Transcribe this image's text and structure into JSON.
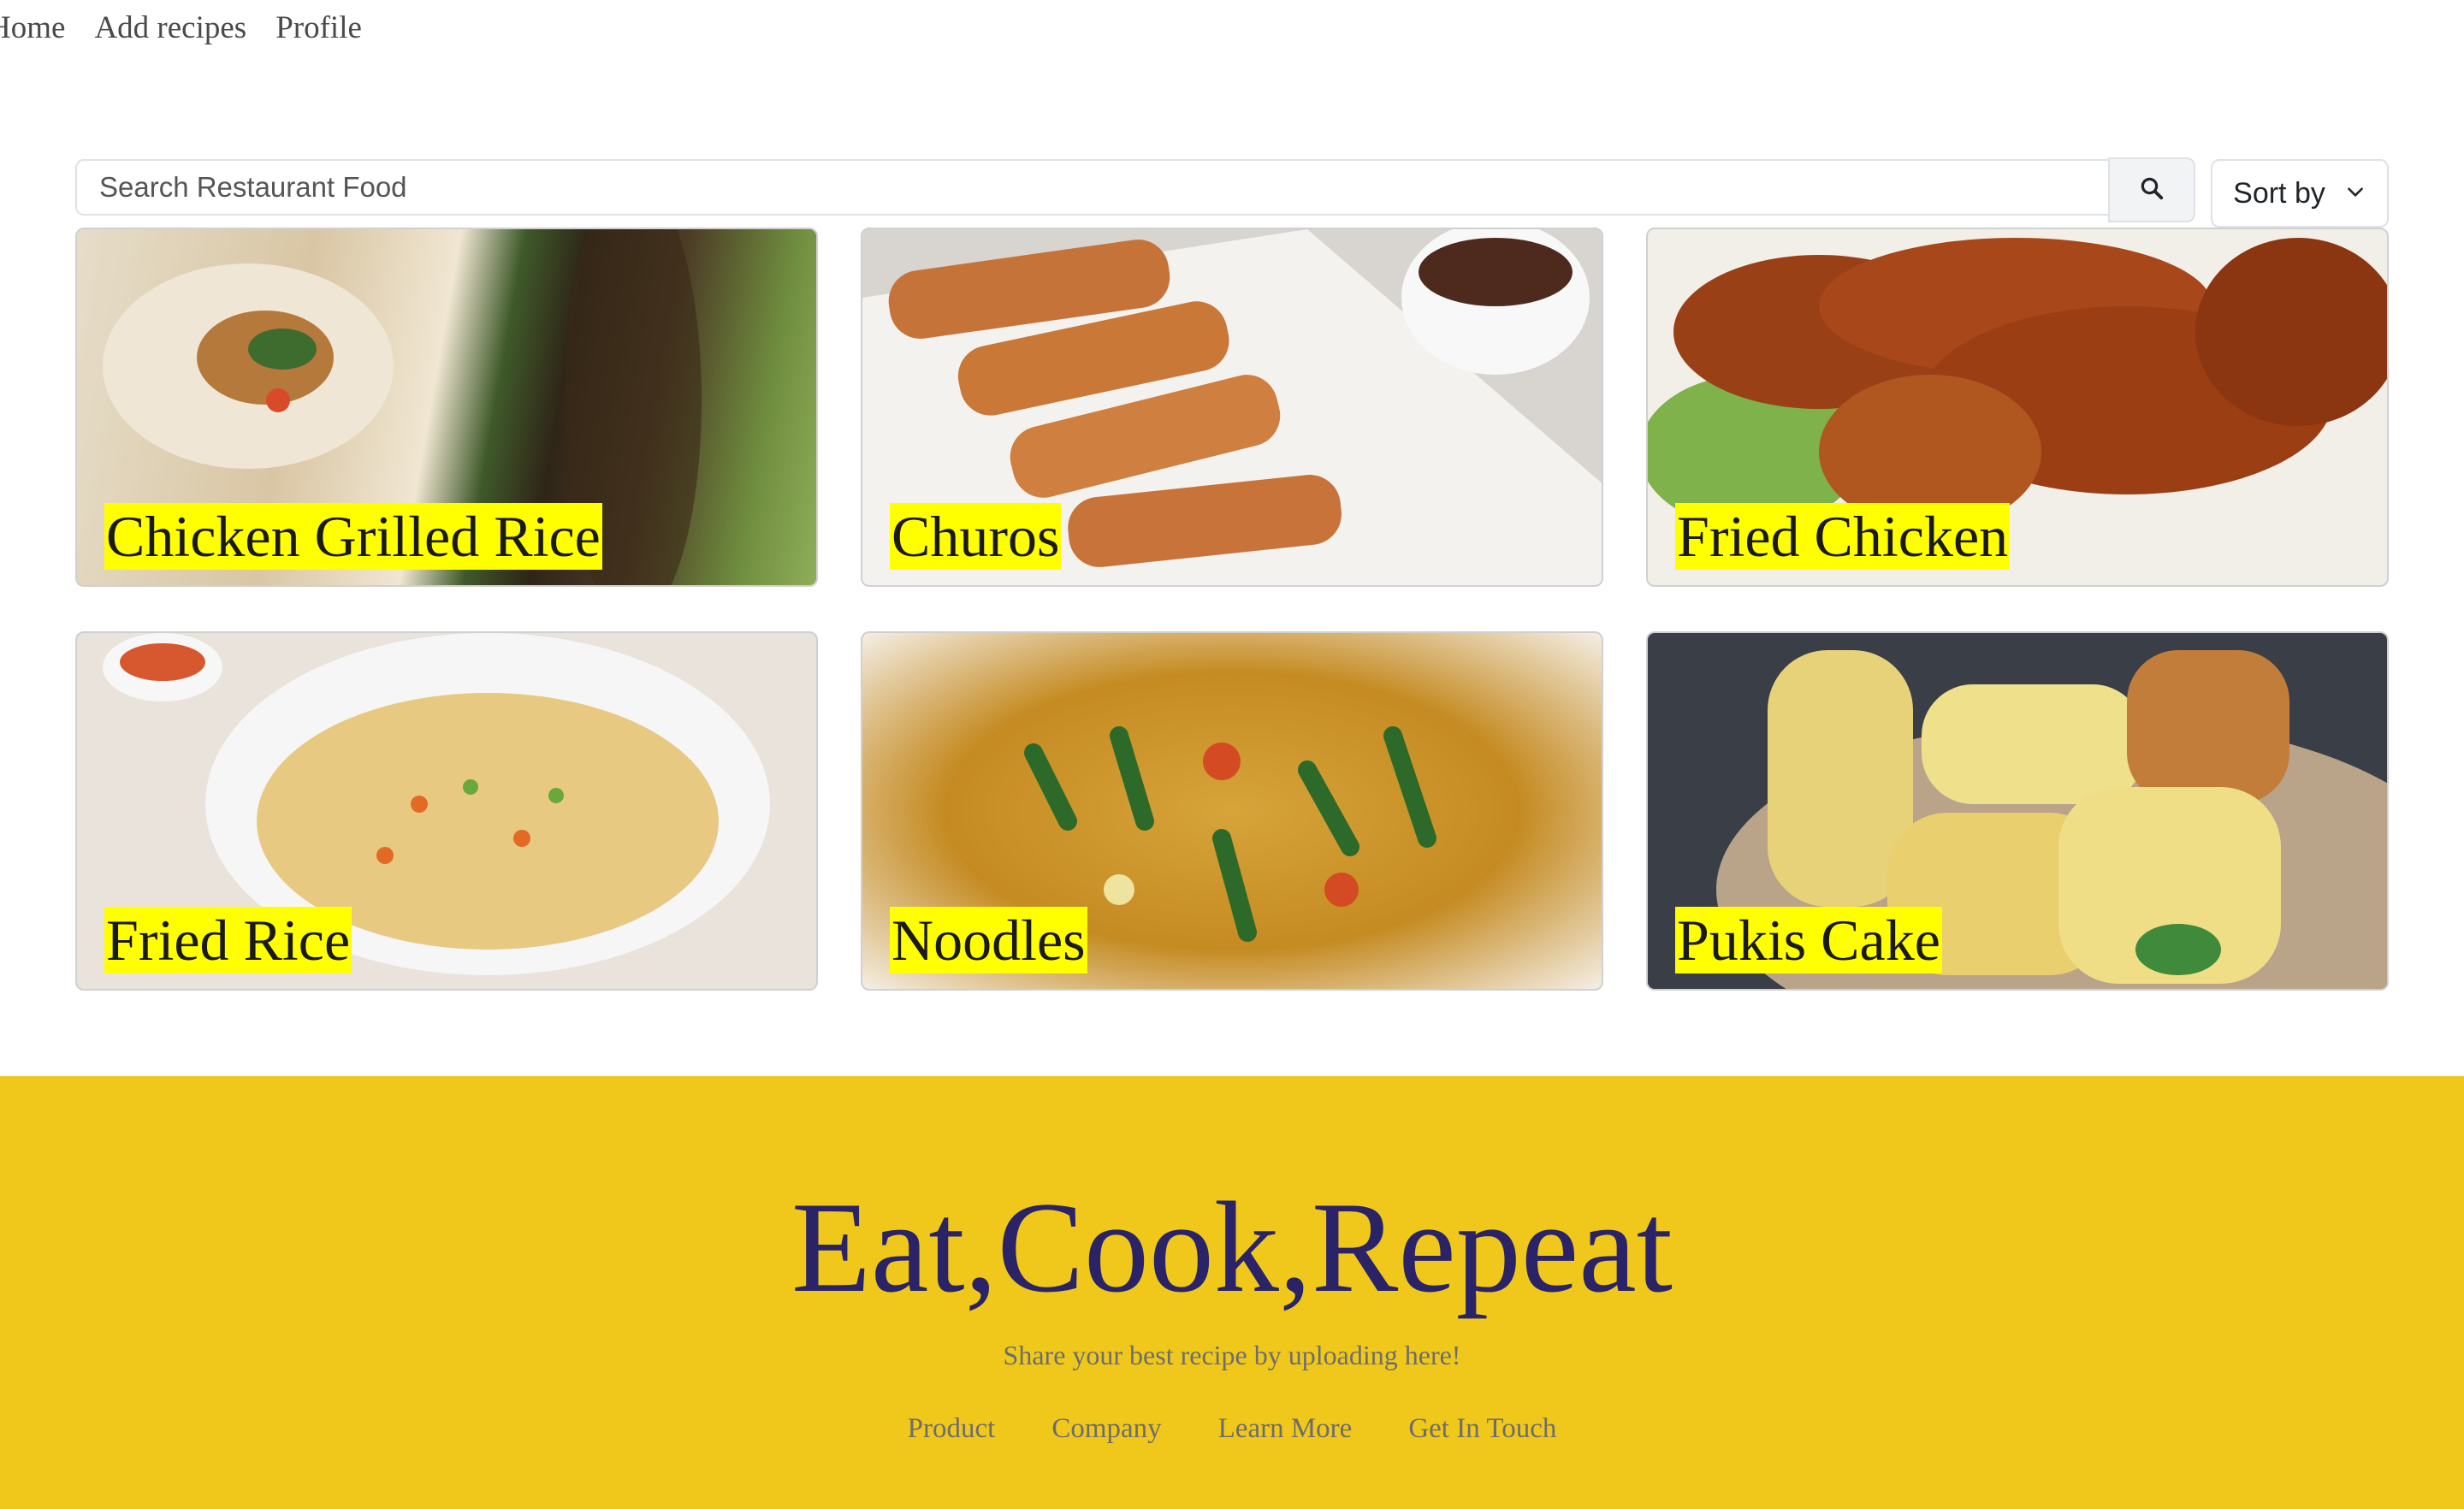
{
  "nav": {
    "items": [
      "Home",
      "Add recipes",
      "Profile"
    ]
  },
  "search": {
    "placeholder": "Search Restaurant Food",
    "value": ""
  },
  "sort": {
    "label": "Sort by"
  },
  "recipes": [
    {
      "title": "Chicken Grilled Rice"
    },
    {
      "title": "Churos"
    },
    {
      "title": "Fried Chicken"
    },
    {
      "title": "Fried Rice"
    },
    {
      "title": "Noodles"
    },
    {
      "title": "Pukis Cake"
    }
  ],
  "footer": {
    "title": "Eat,Cook,Repeat",
    "subtitle": "Share your best recipe by uploading here!",
    "links": [
      "Product",
      "Company",
      "Learn More",
      "Get In Touch"
    ]
  },
  "colors": {
    "footer_bg": "#efc81b",
    "footer_title": "#2a2368",
    "label_highlight": "#ffff00"
  }
}
